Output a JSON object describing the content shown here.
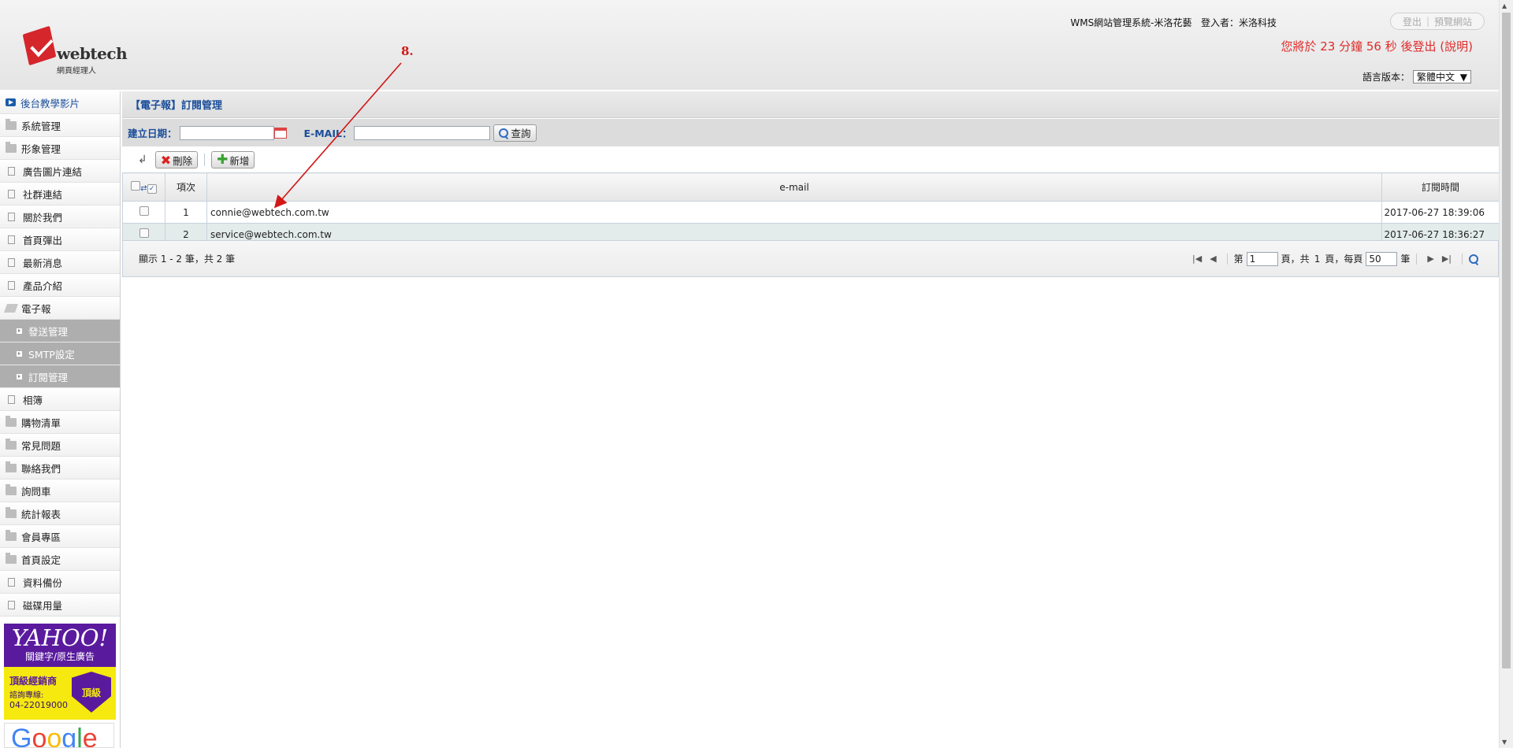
{
  "header": {
    "logo_word": "webtech",
    "logo_sub": "網頁經理人",
    "system_title": "WMS網站管理系統-米洛花藝",
    "login_label": "登入者：",
    "login_user": "米洛科技",
    "logout_label": "登出",
    "preview_label": "預覽網站",
    "logout_timer": "您將於 23 分鐘 56 秒 後登出 (說明)",
    "lang_label": "語言版本：",
    "lang_value": "繁體中文"
  },
  "sidebar": {
    "items": [
      {
        "label": "後台教學影片",
        "icon": "play-icon"
      },
      {
        "label": "系統管理",
        "icon": "folder-icon"
      },
      {
        "label": "形象管理",
        "icon": "folder-icon"
      },
      {
        "label": "廣告圖片連結",
        "icon": "doc-icon"
      },
      {
        "label": "社群連結",
        "icon": "doc-icon"
      },
      {
        "label": "關於我們",
        "icon": "doc-icon"
      },
      {
        "label": "首頁彈出",
        "icon": "doc-icon"
      },
      {
        "label": "最新消息",
        "icon": "doc-icon"
      },
      {
        "label": "產品介紹",
        "icon": "doc-icon"
      },
      {
        "label": "電子報",
        "icon": "open-folder-icon"
      }
    ],
    "sub_items": [
      "發送管理",
      "SMTP設定",
      "訂閱管理"
    ],
    "items_after": [
      {
        "label": "相簿",
        "icon": "doc-icon"
      },
      {
        "label": "購物清單",
        "icon": "folder-icon"
      },
      {
        "label": "常見問題",
        "icon": "folder-icon"
      },
      {
        "label": "聯絡我們",
        "icon": "folder-icon"
      },
      {
        "label": "詢問車",
        "icon": "folder-icon"
      },
      {
        "label": "統計報表",
        "icon": "folder-icon"
      },
      {
        "label": "會員專區",
        "icon": "folder-icon"
      },
      {
        "label": "首頁設定",
        "icon": "folder-icon"
      },
      {
        "label": "資料備份",
        "icon": "doc-icon"
      },
      {
        "label": "磁碟用量",
        "icon": "doc-icon"
      }
    ],
    "ad_yahoo": {
      "brand": "YAHOO!",
      "keywords": "關鍵字/原生廣告",
      "dealer": "頂級經銷商",
      "contact_label": "諮詢專線:",
      "phone": "04-22019000",
      "badge": "頂級"
    },
    "ad_google": "Google"
  },
  "main": {
    "title": "【電子報】訂閱管理",
    "search": {
      "date_label": "建立日期：",
      "date_value": "",
      "email_label": "E-MAIL：",
      "email_value": "",
      "search_button": "查詢"
    },
    "toolbar": {
      "delete_label": "刪除",
      "add_label": "新增"
    },
    "table": {
      "columns": [
        "項次",
        "e-mail",
        "訂閱時間"
      ],
      "rows": [
        {
          "no": "1",
          "email": "connie@webtech.com.tw",
          "time": "2017-06-27 18:39:06"
        },
        {
          "no": "2",
          "email": "service@webtech.com.tw",
          "time": "2017-06-27 18:36:27"
        }
      ]
    },
    "pager": {
      "info": "顯示 1 - 2 筆，共 2 筆",
      "page_prefix": "第",
      "page_value": "1",
      "page_suffix": "頁，共",
      "total_pages": "1",
      "per_page_label": "頁，每頁",
      "per_page_value": "50",
      "unit": "筆"
    }
  },
  "annotation": {
    "label": "8.",
    "color": "#d01818"
  },
  "colors": {
    "accent_blue": "#1a4e9b",
    "alert_red": "#e02b2b",
    "sub_menu_gray": "#aeaeae"
  }
}
